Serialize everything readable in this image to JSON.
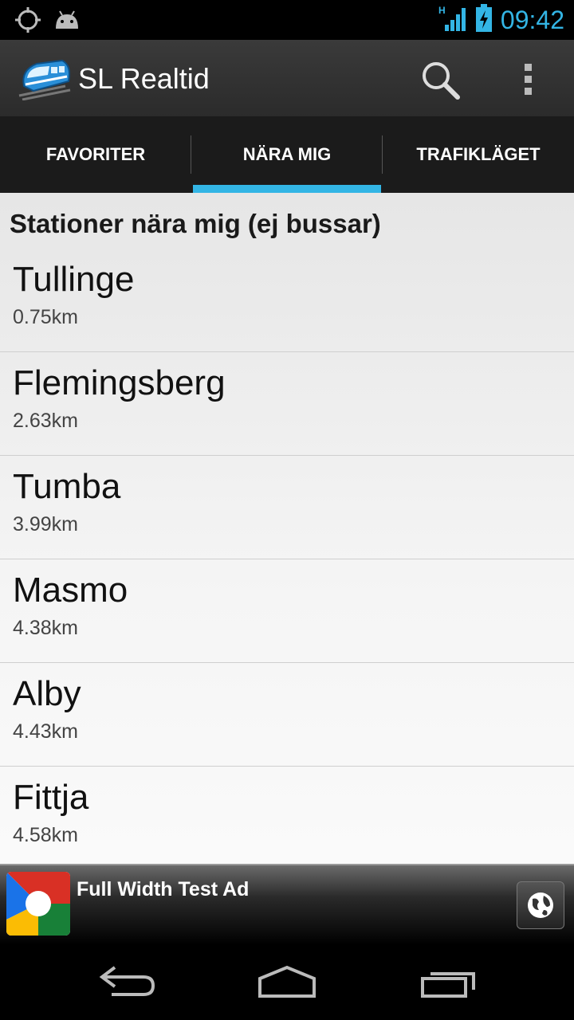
{
  "status_bar": {
    "time": "09:42",
    "network_type": "H",
    "icons": [
      "gps-icon",
      "android-debug-icon",
      "signal-icon",
      "battery-charging-icon"
    ]
  },
  "action_bar": {
    "title": "SL Realtid",
    "icons": [
      "train-app-icon",
      "search-icon",
      "overflow-menu-icon"
    ]
  },
  "tabs": [
    {
      "label": "FAVORITER",
      "selected": false
    },
    {
      "label": "NÄRA MIG",
      "selected": true
    },
    {
      "label": "TRAFIKLÄGET",
      "selected": false
    }
  ],
  "content": {
    "header": "Stationer nära mig (ej bussar)",
    "stations": [
      {
        "name": "Tullinge",
        "distance": "0.75km"
      },
      {
        "name": "Flemingsberg",
        "distance": "2.63km"
      },
      {
        "name": "Tumba",
        "distance": "3.99km"
      },
      {
        "name": "Masmo",
        "distance": "4.38km"
      },
      {
        "name": "Alby",
        "distance": "4.43km"
      },
      {
        "name": "Fittja",
        "distance": "4.58km"
      }
    ]
  },
  "ad": {
    "text": "Full Width Test Ad",
    "icons": [
      "google-logo-icon",
      "globe-icon"
    ]
  },
  "nav_bar": {
    "icons": [
      "back-icon",
      "home-icon",
      "recent-apps-icon"
    ]
  },
  "colors": {
    "accent": "#33b5e5",
    "action_bar": "#333333",
    "tab_bar": "#1b1b1b"
  }
}
